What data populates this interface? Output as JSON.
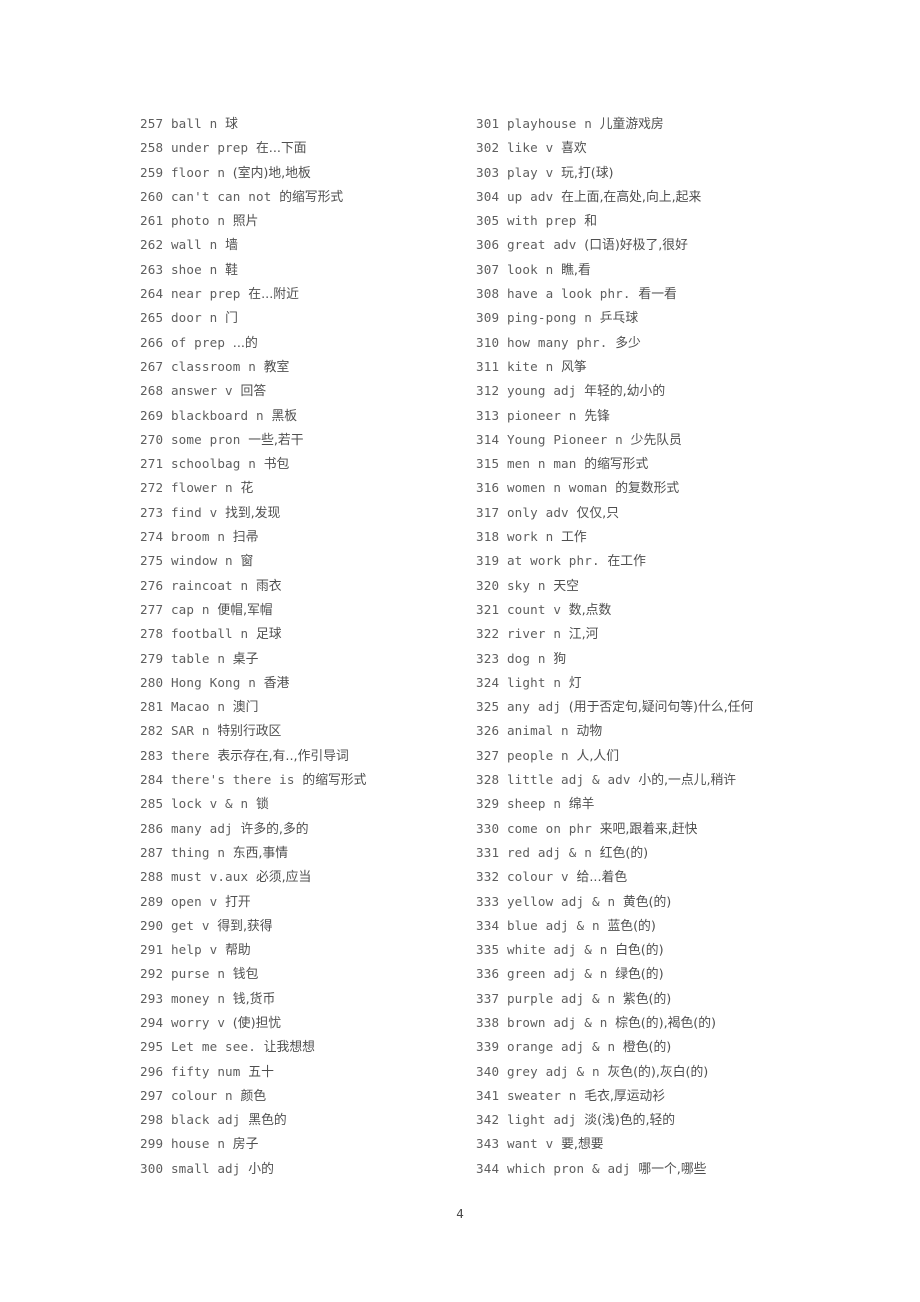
{
  "document": {
    "page_number": "4",
    "text_color": "#5e5e5e"
  },
  "columns": {
    "left": [
      {
        "num": "257",
        "word": "ball n",
        "cn": "球"
      },
      {
        "num": "258",
        "word": "under prep",
        "cn": "在...下面"
      },
      {
        "num": "259",
        "word": "floor n",
        "cn": "(室内)地,地板"
      },
      {
        "num": "260",
        "word": "can't can not",
        "cn": "的缩写形式"
      },
      {
        "num": "261",
        "word": "photo n",
        "cn": "照片"
      },
      {
        "num": "262",
        "word": "wall n",
        "cn": "墙"
      },
      {
        "num": "263",
        "word": "shoe n",
        "cn": "鞋"
      },
      {
        "num": "264",
        "word": "near prep",
        "cn": "在...附近"
      },
      {
        "num": "265",
        "word": "door n",
        "cn": "门"
      },
      {
        "num": "266",
        "word": "of prep",
        "cn": "...的"
      },
      {
        "num": "267",
        "word": "classroom n",
        "cn": "教室"
      },
      {
        "num": "268",
        "word": "answer v",
        "cn": "回答"
      },
      {
        "num": "269",
        "word": "blackboard n",
        "cn": "黑板"
      },
      {
        "num": "270",
        "word": "some pron",
        "cn": "一些,若干"
      },
      {
        "num": "271",
        "word": "schoolbag n",
        "cn": "书包"
      },
      {
        "num": "272",
        "word": "flower n",
        "cn": "花"
      },
      {
        "num": "273",
        "word": "find v",
        "cn": "找到,发现"
      },
      {
        "num": "274",
        "word": "broom n",
        "cn": "扫帚"
      },
      {
        "num": "275",
        "word": "window n",
        "cn": "窗"
      },
      {
        "num": "276",
        "word": "raincoat n",
        "cn": "雨衣"
      },
      {
        "num": "277",
        "word": "cap n",
        "cn": "便帽,军帽"
      },
      {
        "num": "278",
        "word": "football n",
        "cn": "足球"
      },
      {
        "num": "279",
        "word": "table n",
        "cn": "桌子"
      },
      {
        "num": "280",
        "word": "Hong Kong n",
        "cn": "香港"
      },
      {
        "num": "281",
        "word": "Macao n",
        "cn": "澳门"
      },
      {
        "num": "282",
        "word": "SAR n",
        "cn": "特别行政区"
      },
      {
        "num": "283",
        "word": "there",
        "cn": "表示存在,有..,作引导词"
      },
      {
        "num": "284",
        "word": "there's there is",
        "cn": "的缩写形式"
      },
      {
        "num": "285",
        "word": "lock v & n",
        "cn": "锁"
      },
      {
        "num": "286",
        "word": "many adj",
        "cn": "许多的,多的"
      },
      {
        "num": "287",
        "word": "thing n",
        "cn": "东西,事情"
      },
      {
        "num": "288",
        "word": "must v.aux",
        "cn": "必须,应当"
      },
      {
        "num": "289",
        "word": "open v",
        "cn": "打开"
      },
      {
        "num": "290",
        "word": "get v",
        "cn": "得到,获得"
      },
      {
        "num": "291",
        "word": "help v",
        "cn": "帮助"
      },
      {
        "num": "292",
        "word": "purse n",
        "cn": "钱包"
      },
      {
        "num": "293",
        "word": "money n",
        "cn": "钱,货币"
      },
      {
        "num": "294",
        "word": "worry v",
        "cn": "(使)担忧"
      },
      {
        "num": "295",
        "word": "Let me see.",
        "cn": "让我想想"
      },
      {
        "num": "296",
        "word": "fifty num",
        "cn": "五十"
      },
      {
        "num": "297",
        "word": "colour n",
        "cn": "颜色"
      },
      {
        "num": "298",
        "word": "black adj",
        "cn": "黑色的"
      },
      {
        "num": "299",
        "word": "house n",
        "cn": "房子"
      },
      {
        "num": "300",
        "word": "small adj",
        "cn": "小的"
      }
    ],
    "right": [
      {
        "num": "301",
        "word": "playhouse n",
        "cn": "儿童游戏房"
      },
      {
        "num": "302",
        "word": "like v",
        "cn": "喜欢"
      },
      {
        "num": "303",
        "word": "play v",
        "cn": "玩,打(球)"
      },
      {
        "num": "304",
        "word": "up adv",
        "cn": "在上面,在高处,向上,起来"
      },
      {
        "num": "305",
        "word": "with prep",
        "cn": "和"
      },
      {
        "num": "306",
        "word": "great adv",
        "cn": "(口语)好极了,很好"
      },
      {
        "num": "307",
        "word": "look n",
        "cn": "瞧,看"
      },
      {
        "num": "308",
        "word": "have a look phr.",
        "cn": "看一看"
      },
      {
        "num": "309",
        "word": "ping-pong n",
        "cn": "乒乓球"
      },
      {
        "num": "310",
        "word": "how many phr.",
        "cn": "多少"
      },
      {
        "num": "311",
        "word": "kite n",
        "cn": "风筝"
      },
      {
        "num": "312",
        "word": "young adj",
        "cn": "年轻的,幼小的"
      },
      {
        "num": "313",
        "word": "pioneer n",
        "cn": "先锋"
      },
      {
        "num": "314",
        "word": "Young Pioneer n",
        "cn": "少先队员"
      },
      {
        "num": "315",
        "word": "men n man",
        "cn": "的缩写形式"
      },
      {
        "num": "316",
        "word": "women n woman",
        "cn": "的复数形式"
      },
      {
        "num": "317",
        "word": "only adv",
        "cn": "仅仅,只"
      },
      {
        "num": "318",
        "word": "work n",
        "cn": "工作"
      },
      {
        "num": "319",
        "word": "at work phr.",
        "cn": "在工作"
      },
      {
        "num": "320",
        "word": "sky n",
        "cn": "天空"
      },
      {
        "num": "321",
        "word": "count v",
        "cn": "数,点数"
      },
      {
        "num": "322",
        "word": "river n",
        "cn": "江,河"
      },
      {
        "num": "323",
        "word": "dog n",
        "cn": "狗"
      },
      {
        "num": "324",
        "word": "light n",
        "cn": "灯"
      },
      {
        "num": "325",
        "word": "any adj",
        "cn": "(用于否定句,疑问句等)什么,任何"
      },
      {
        "num": "326",
        "word": "animal n",
        "cn": "动物"
      },
      {
        "num": "327",
        "word": "people n",
        "cn": "人,人们"
      },
      {
        "num": "328",
        "word": "little adj & adv",
        "cn": "小的,一点儿,稍许"
      },
      {
        "num": "329",
        "word": "sheep n",
        "cn": "绵羊"
      },
      {
        "num": "330",
        "word": "come on phr",
        "cn": "来吧,跟着来,赶快"
      },
      {
        "num": "331",
        "word": "red adj & n",
        "cn": "红色(的)"
      },
      {
        "num": "332",
        "word": "colour v",
        "cn": "给...着色"
      },
      {
        "num": "333",
        "word": "yellow adj & n",
        "cn": "黄色(的)"
      },
      {
        "num": "334",
        "word": "blue adj & n",
        "cn": "蓝色(的)"
      },
      {
        "num": "335",
        "word": "white adj & n",
        "cn": "白色(的)"
      },
      {
        "num": "336",
        "word": "green adj & n",
        "cn": "绿色(的)"
      },
      {
        "num": "337",
        "word": "purple adj & n",
        "cn": "紫色(的)"
      },
      {
        "num": "338",
        "word": "brown adj & n",
        "cn": "棕色(的),褐色(的)"
      },
      {
        "num": "339",
        "word": "orange adj & n",
        "cn": "橙色(的)"
      },
      {
        "num": "340",
        "word": "grey adj & n",
        "cn": "灰色(的),灰白(的)"
      },
      {
        "num": "341",
        "word": "sweater n",
        "cn": "毛衣,厚运动衫"
      },
      {
        "num": "342",
        "word": "light adj",
        "cn": "淡(浅)色的,轻的"
      },
      {
        "num": "343",
        "word": "want v",
        "cn": "要,想要"
      },
      {
        "num": "344",
        "word": "which pron & adj",
        "cn": "哪一个,哪些"
      }
    ]
  }
}
